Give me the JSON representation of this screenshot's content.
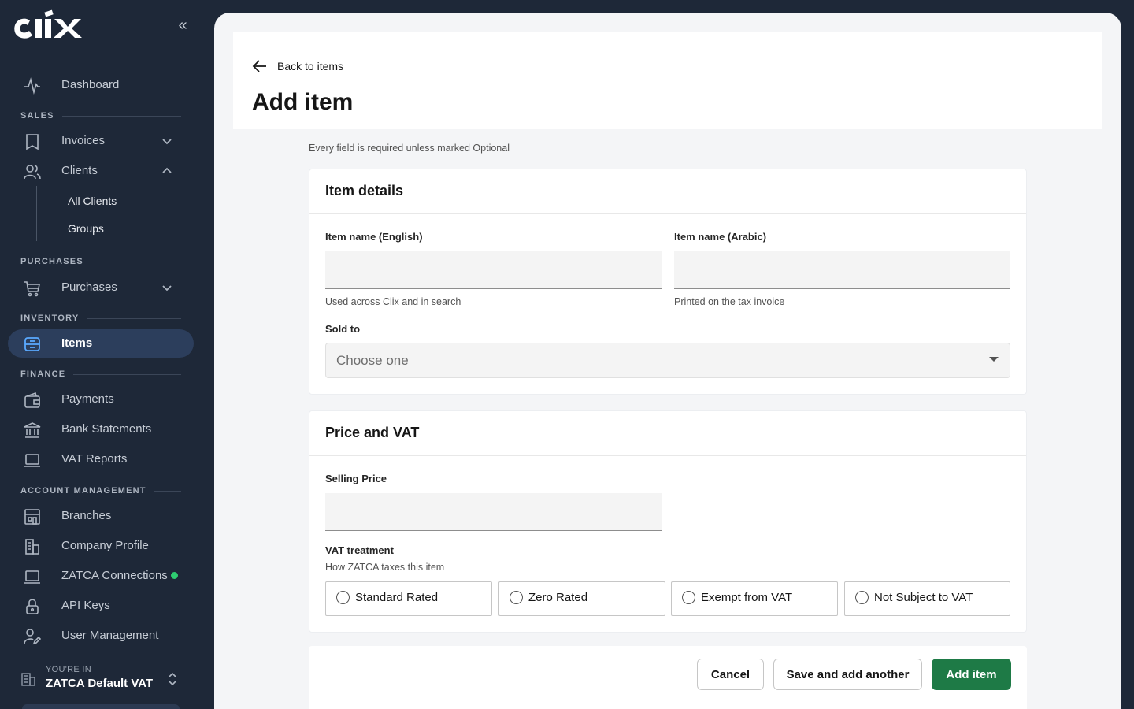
{
  "app": {
    "logo_text": "CLIX"
  },
  "sidebar": {
    "collapse_glyph": "«",
    "dashboard": {
      "label": "Dashboard",
      "icon": "pulse-icon"
    },
    "sections": {
      "sales": "SALES",
      "purchases": "PURCHASES",
      "inventory": "INVENTORY",
      "finance": "FINANCE",
      "account_management": "ACCOUNT MANAGEMENT"
    },
    "invoices": {
      "label": "Invoices",
      "icon": "receipt-icon"
    },
    "clients": {
      "label": "Clients",
      "icon": "users-icon",
      "children": [
        "All Clients",
        "Groups"
      ]
    },
    "purchases": {
      "label": "Purchases",
      "icon": "cart-icon"
    },
    "items": {
      "label": "Items",
      "icon": "box-icon"
    },
    "payments": {
      "label": "Payments",
      "icon": "wallet-icon"
    },
    "bank_statements": {
      "label": "Bank Statements",
      "icon": "bank-icon"
    },
    "vat_reports": {
      "label": "VAT Reports",
      "icon": "laptop-icon"
    },
    "branches": {
      "label": "Branches",
      "icon": "store-icon"
    },
    "company_profile": {
      "label": "Company Profile",
      "icon": "building-icon"
    },
    "zatca_connections": {
      "label": "ZATCA Connections",
      "icon": "laptop-icon",
      "status_color": "#2ecc71"
    },
    "api_keys": {
      "label": "API Keys",
      "icon": "lock-icon"
    },
    "user_management": {
      "label": "User Management",
      "icon": "user-edit-icon"
    },
    "org_switcher": {
      "caption": "YOU'RE IN",
      "name": "ZATCA Default VAT"
    }
  },
  "page": {
    "back_label": "Back to items",
    "title": "Add item",
    "hint": "Every field is required unless marked Optional"
  },
  "item_details": {
    "title": "Item details",
    "name_en": {
      "label": "Item name (English)",
      "value": "",
      "help": "Used across Clix and in search"
    },
    "name_ar": {
      "label": "Item name (Arabic)",
      "value": "",
      "help": "Printed on the tax invoice"
    },
    "sold_to": {
      "label": "Sold to",
      "placeholder": "Choose one"
    }
  },
  "price_vat": {
    "title": "Price and VAT",
    "selling_price": {
      "label": "Selling Price",
      "value": ""
    },
    "vat_treatment": {
      "label": "VAT treatment",
      "help": "How ZATCA taxes this item",
      "options": [
        "Standard Rated",
        "Zero Rated",
        "Exempt from VAT",
        "Not Subject to VAT"
      ]
    }
  },
  "actions": {
    "cancel": "Cancel",
    "save_another": "Save and add another",
    "submit": "Add item"
  },
  "colors": {
    "sidebar_bg": "#1e2838",
    "active_item_bg": "#2c3e5c",
    "primary": "#1e7a46"
  }
}
